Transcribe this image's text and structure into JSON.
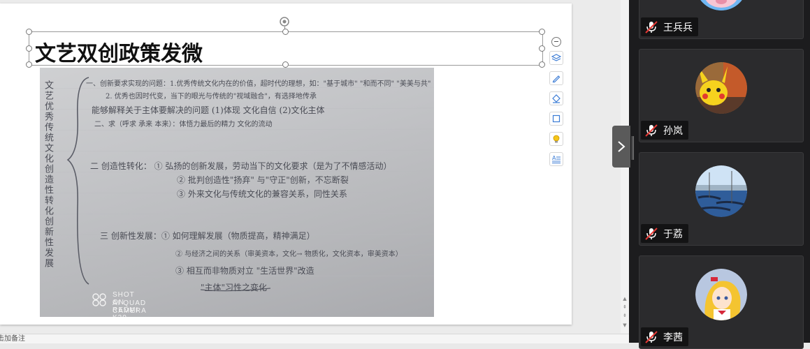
{
  "slide": {
    "title": "文艺双创政策发微",
    "photo": {
      "vertical_heading": "文艺优秀传统文化创造性转化创新性发展",
      "lines": [
        "一、创新要求实现的问题：1.优秀传统文化内在的价值，超时代的理想，如：\"基于城市\" \"和而不同\" \"美美与共\"",
        "2. 优秀也因时代变，当下的眼光与传统的\"视域融合\"，有选择地传承",
        "能够解释关于主体要解决的问题 (1)体现 文化自信  (2)文化主体",
        "二、求（呼求 承来 本来）：体悟力最后的精力 文化的流动",
        "二  创造性转化：  ① 弘扬的创新发展，劳动当下的文化要求（是为了不情感活动）",
        "② 批判创造性\"扬弃\"  与\"守正\"创新，不忘断裂",
        "③ 外来文化与传统文化的兼容关系，同性关系",
        "三  创新性发展：① 如何理解发展（物质提高，精神满足）",
        "② 与经济之间的关系（审美资本，文化→ 物质化，文化资本，审美资本）",
        "③ 相互而非物质对立 \"生活世界\"改造",
        "\"主体\"习性之变化"
      ],
      "watermark_line1": "SHOT ON REDMI K30",
      "watermark_line2": "AI QUAD CAMERA"
    }
  },
  "toolbar": {
    "items": [
      {
        "name": "collapse-icon"
      },
      {
        "name": "layers-icon"
      },
      {
        "name": "pen-icon"
      },
      {
        "name": "fill-icon"
      },
      {
        "name": "outline-icon"
      },
      {
        "name": "lightbulb-icon"
      },
      {
        "name": "text-format-icon"
      }
    ]
  },
  "notes": {
    "label": "击加备注"
  },
  "participants": [
    {
      "name": "王兵兵",
      "muted": true,
      "avatar": "pig-avatar"
    },
    {
      "name": "孙岚",
      "muted": true,
      "avatar": "pikachu-avatar"
    },
    {
      "name": "于荔",
      "muted": true,
      "avatar": "venice-avatar"
    },
    {
      "name": "李茜",
      "muted": true,
      "avatar": "anime-girl-avatar"
    }
  ],
  "colors": {
    "panel_bg": "#1c1c1e",
    "tile_bg": "#2b2b2d",
    "mic_muted": "#ffffff",
    "mic_slash": "#e53935",
    "pig_sky": "#6fb6f2"
  }
}
